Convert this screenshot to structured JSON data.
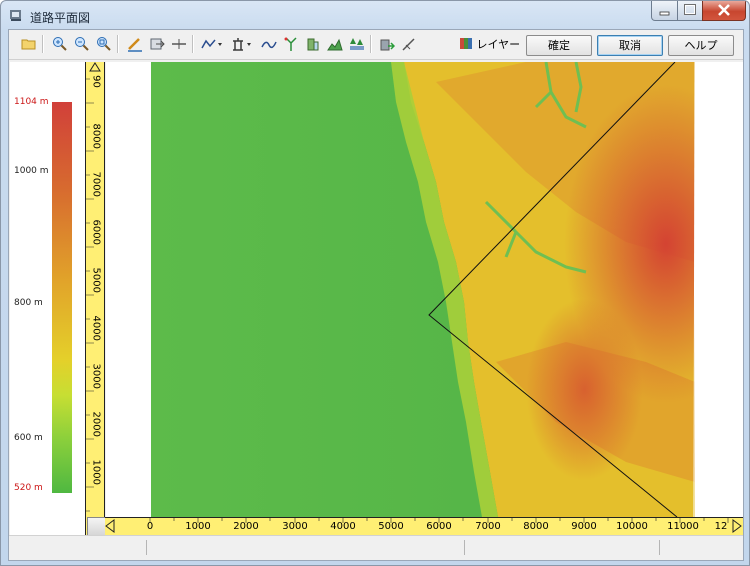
{
  "window": {
    "title": "道路平面図",
    "controls": {
      "minimize_icon": "minimize-icon",
      "maximize_icon": "maximize-icon",
      "close_icon": "close-icon"
    }
  },
  "toolbar": {
    "tools": [
      {
        "name": "open-folder-icon"
      },
      {
        "name": "zoom-in-icon"
      },
      {
        "name": "zoom-out-icon"
      },
      {
        "name": "zoom-fit-icon"
      },
      {
        "name": "draw-line-icon"
      },
      {
        "name": "move-icon"
      },
      {
        "name": "section-cut-icon"
      },
      {
        "name": "polyline-dropdown-icon"
      },
      {
        "name": "tower-dropdown-icon"
      },
      {
        "name": "curve-icon"
      },
      {
        "name": "tree-branch-icon"
      },
      {
        "name": "building-icon"
      },
      {
        "name": "terrain-profile-icon"
      },
      {
        "name": "forest-icon"
      },
      {
        "name": "export-icon"
      },
      {
        "name": "pen-edit-icon"
      }
    ],
    "layer_label": "レイヤー",
    "confirm_label": "確定",
    "cancel_label": "取消",
    "help_label": "ヘルプ"
  },
  "legend": {
    "max": "1104 m",
    "l1000": "1000 m",
    "l800": "800 m",
    "l600": "600 m",
    "min": "520 m",
    "colors": {
      "high": "#d1403a",
      "mid": "#e1a42a",
      "low": "#4fb841"
    }
  },
  "vertical_ruler": {
    "ticks": [
      "1000",
      "2000",
      "3000",
      "4000",
      "5000",
      "6000",
      "7000",
      "8000",
      "90"
    ]
  },
  "horizontal_ruler": {
    "ticks": [
      "0",
      "1000",
      "2000",
      "3000",
      "4000",
      "5000",
      "6000",
      "7000",
      "8000",
      "9000",
      "10000",
      "11000",
      "12"
    ]
  },
  "map": {
    "description_colors": {
      "lowland": "#55b947",
      "highland": "#e0a12d",
      "peak": "#d14a32"
    }
  }
}
